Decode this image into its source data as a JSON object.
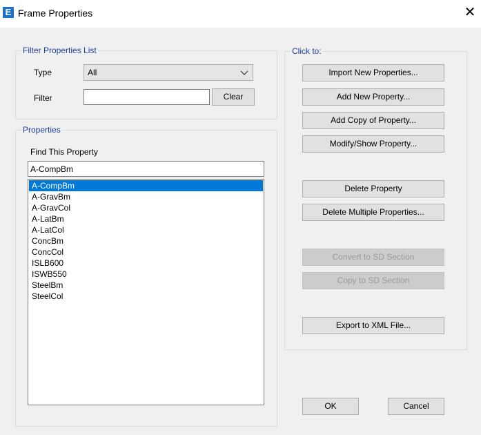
{
  "window": {
    "title": "Frame Properties",
    "app_icon_letter": "E",
    "close_glyph": "✕"
  },
  "filter": {
    "legend": "Filter Properties List",
    "type_label": "Type",
    "type_value": "All",
    "filter_label": "Filter",
    "filter_value": "",
    "clear_button": "Clear"
  },
  "properties": {
    "legend": "Properties",
    "find_label": "Find This Property",
    "find_value": "A-CompBm",
    "items": [
      "A-CompBm",
      "A-GravBm",
      "A-GravCol",
      "A-LatBm",
      "A-LatCol",
      "ConcBm",
      "ConcCol",
      "ISLB600",
      "ISWB550",
      "SteelBm",
      "SteelCol"
    ],
    "selected_index": 0
  },
  "click_to": {
    "legend": "Click to:",
    "import_button": "Import New Properties...",
    "add_new_button": "Add New Property...",
    "add_copy_button": "Add Copy of Property...",
    "modify_button": "Modify/Show Property...",
    "delete_button": "Delete Property",
    "delete_multiple_button": "Delete Multiple Properties...",
    "convert_sd_button": "Convert to SD Section",
    "copy_sd_button": "Copy to SD Section",
    "export_xml_button": "Export to XML File..."
  },
  "footer": {
    "ok_button": "OK",
    "cancel_button": "Cancel"
  },
  "colors": {
    "legend_text": "#1c3d99",
    "selection": "#0078d7",
    "dialog_bg": "#f0f0f0"
  }
}
